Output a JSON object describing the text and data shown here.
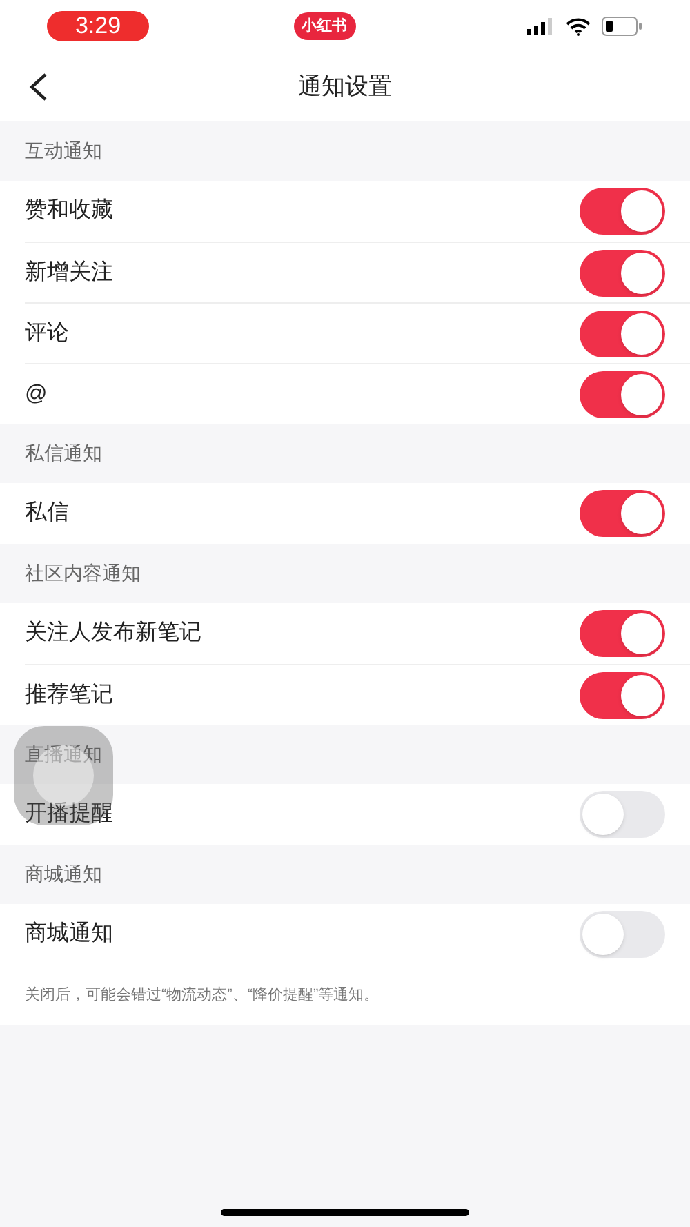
{
  "status_bar": {
    "time": "3:29",
    "app_badge": "小红书"
  },
  "nav": {
    "title": "通知设置"
  },
  "sections": [
    {
      "title": "互动通知",
      "items": [
        {
          "label": "赞和收藏",
          "on": true
        },
        {
          "label": "新增关注",
          "on": true
        },
        {
          "label": "评论",
          "on": true
        },
        {
          "label": "@",
          "on": true
        }
      ]
    },
    {
      "title": "私信通知",
      "items": [
        {
          "label": "私信",
          "on": true
        }
      ]
    },
    {
      "title": "社区内容通知",
      "items": [
        {
          "label": "关注人发布新笔记",
          "on": true
        },
        {
          "label": "推荐笔记",
          "on": true
        }
      ]
    },
    {
      "title": "直播通知",
      "items": [
        {
          "label": "开播提醒",
          "on": false
        }
      ]
    },
    {
      "title": "商城通知",
      "items": [
        {
          "label": "商城通知",
          "on": false
        }
      ],
      "note": "关闭后，可能会错过“物流动态”、“降价提醒”等通知。"
    }
  ]
}
